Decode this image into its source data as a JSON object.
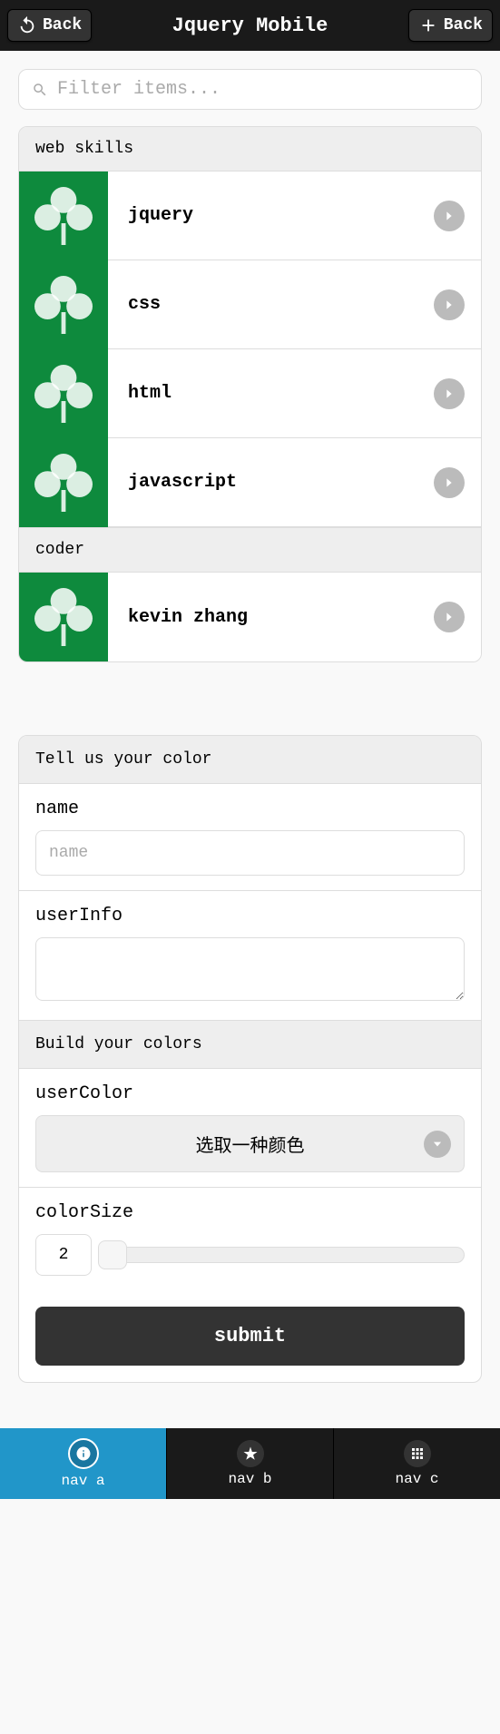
{
  "header": {
    "back_left": "Back",
    "title": "Jquery Mobile",
    "back_right": "Back"
  },
  "filter": {
    "placeholder": "Filter items..."
  },
  "list": {
    "divider1": "web skills",
    "divider2": "coder",
    "skills": [
      {
        "label": "jquery"
      },
      {
        "label": "css"
      },
      {
        "label": "html"
      },
      {
        "label": "javascript"
      }
    ],
    "coders": [
      {
        "label": "kevin zhang"
      }
    ]
  },
  "form": {
    "header1": "Tell us your color",
    "name_label": "name",
    "name_placeholder": "name",
    "userinfo_label": "userInfo",
    "header2": "Build your colors",
    "usercolor_label": "userColor",
    "usercolor_select": "选取一种颜色",
    "colorsize_label": "colorSize",
    "colorsize_value": "2",
    "submit": "submit"
  },
  "nav": {
    "a": "nav a",
    "b": "nav b",
    "c": "nav c"
  }
}
